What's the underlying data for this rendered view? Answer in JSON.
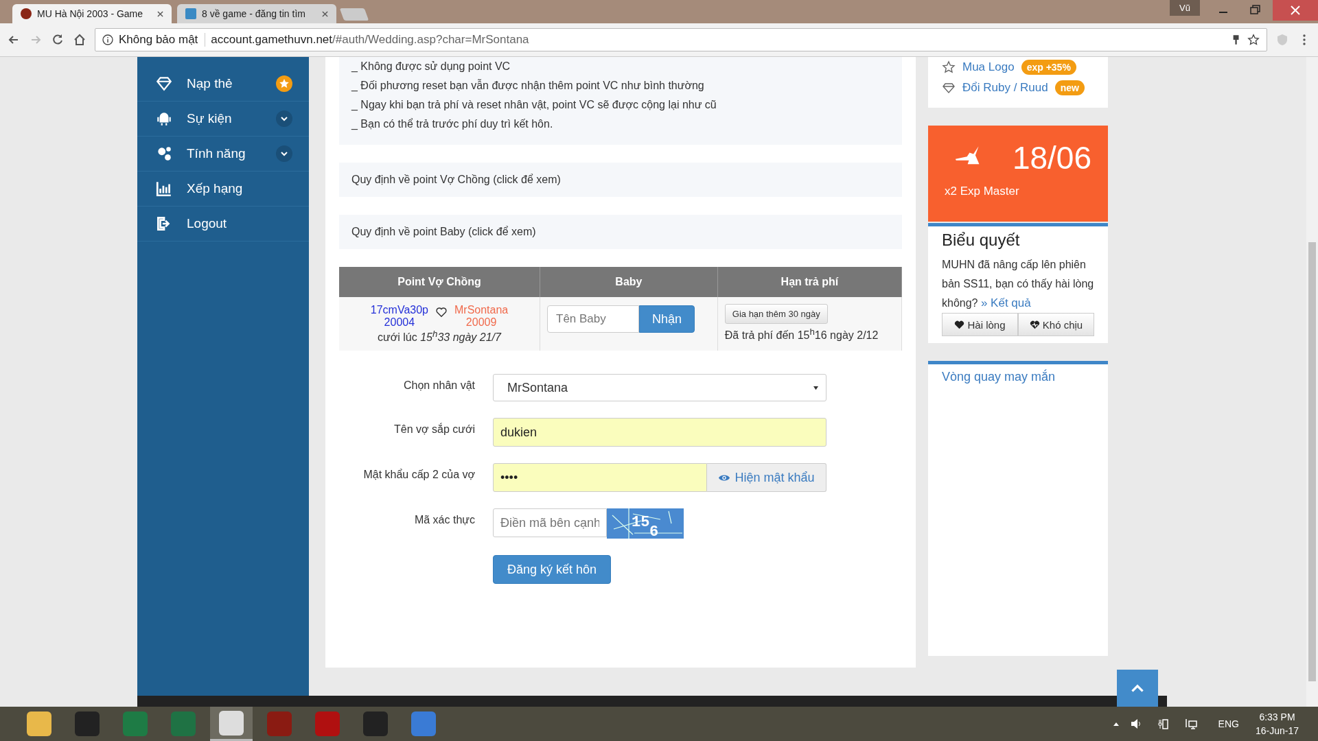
{
  "browser": {
    "tabs": [
      {
        "title": "MU Hà Nội 2003 - Game",
        "selected": true
      },
      {
        "title": "8 về game - đăng tin tìm",
        "selected": false
      }
    ],
    "profile": "Vũ",
    "address": {
      "security": "Không bảo mật",
      "host": "account.gamethuvn.net",
      "path": "/#auth/Wedding.asp?char=MrSontana"
    }
  },
  "sidebar": {
    "items": [
      {
        "label": "Nạp thẻ",
        "kind": "star"
      },
      {
        "label": "Sự kiện",
        "kind": "expand"
      },
      {
        "label": "Tính năng",
        "kind": "expand"
      },
      {
        "label": "Xếp hạng",
        "kind": "plain"
      },
      {
        "label": "Logout",
        "kind": "plain"
      }
    ]
  },
  "notes": [
    "_ Không được sử dụng point VC",
    "_ Đối phương reset bạn vẫn được nhận thêm point VC như bình thường",
    "_ Ngay khi bạn trả phí và reset nhân vật, point VC sẽ được cộng lại như cũ",
    "_ Bạn có thể trả trước phí duy trì kết hôn."
  ],
  "panels": [
    "Quy định về point Vợ Chồng (click để xem)",
    "Quy định về point Baby (click để xem)"
  ],
  "table": {
    "columns": [
      "Point Vợ Chồng",
      "Baby",
      "Hạn trả phí"
    ],
    "row": {
      "husband": "17cmVa30p",
      "husband_point": "20004",
      "wife": "MrSontana",
      "wife_point": "20009",
      "married": "cưới lúc *15$^{h}$33 ngày 21/7*",
      "baby_placeholder": "Tên Baby",
      "baby_button": "Nhận",
      "extend_button": "Gia hạn thêm 30 ngày",
      "paid": "Đã trả phí đến 15$^{h}$16 ngày 2/12"
    }
  },
  "form": {
    "fields": [
      {
        "label": "Chọn nhân vật",
        "kind": "select",
        "value": "MrSontana"
      },
      {
        "label": "Tên vợ sắp cưới",
        "kind": "text",
        "value": "dukien"
      },
      {
        "label": "Mật khẩu cấp 2 của vợ",
        "kind": "password",
        "value": "••••",
        "addon": "Hiện mật khẩu"
      },
      {
        "label": "Mã xác thực",
        "kind": "captcha",
        "placeholder": "Điền mã bên cạnh",
        "captcha": [
          "15",
          "6"
        ]
      }
    ],
    "submit": "Đăng ký kết hôn"
  },
  "right": {
    "links": [
      {
        "label": "Mua Logo",
        "badge": "exp +35%"
      },
      {
        "label": "Đổi Ruby / Ruud",
        "badge": "new"
      }
    ],
    "event": {
      "date": "18/06",
      "caption": "x2 Exp Master"
    },
    "poll": {
      "title": "Biểu quyết",
      "question": "MUHN đã nâng cấp lên phiên bản SS11, bạn có thấy hài lòng không?",
      "result": "» Kết quả",
      "options": [
        "Hài lòng",
        "Khó chịu"
      ]
    },
    "lucky": "Vòng quay may mắn"
  },
  "taskbar": {
    "apps": [
      {
        "selected": false
      },
      {
        "selected": false
      },
      {
        "selected": false
      },
      {
        "selected": false
      },
      {
        "selected": true
      },
      {
        "selected": false
      },
      {
        "selected": false
      },
      {
        "selected": false
      },
      {
        "selected": false
      }
    ],
    "language": "ENG",
    "time": "6:33 PM",
    "date": "16-Jun-17"
  }
}
